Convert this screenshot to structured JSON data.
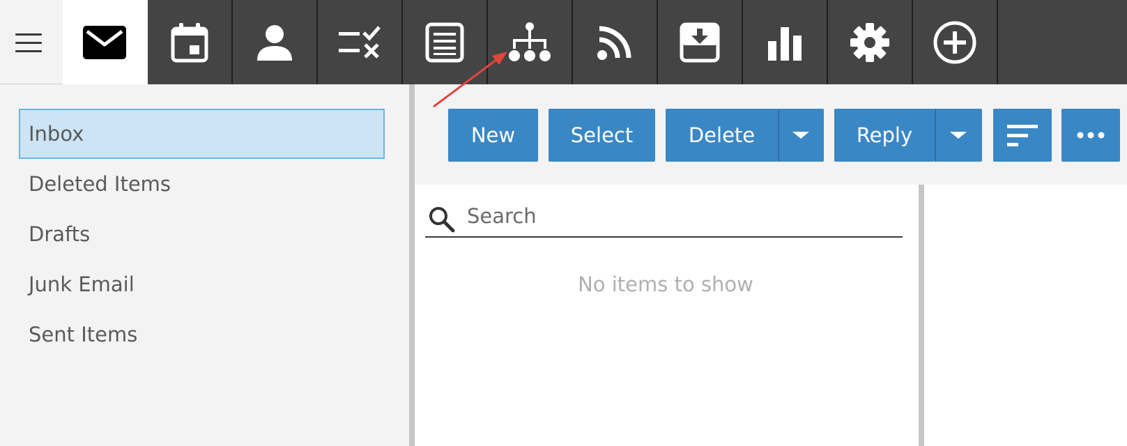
{
  "nav": {
    "tabs": [
      {
        "icon": "mail-icon",
        "active": true
      },
      {
        "icon": "calendar-icon",
        "active": false
      },
      {
        "icon": "person-icon",
        "active": false
      },
      {
        "icon": "tasks-icon",
        "active": false
      },
      {
        "icon": "notes-icon",
        "active": false
      },
      {
        "icon": "org-chart-icon",
        "active": false
      },
      {
        "icon": "rss-icon",
        "active": false
      },
      {
        "icon": "archive-icon",
        "active": false
      },
      {
        "icon": "bar-chart-icon",
        "active": false
      },
      {
        "icon": "gear-icon",
        "active": false
      },
      {
        "icon": "add-circle-icon",
        "active": false
      }
    ]
  },
  "folders": {
    "items": [
      {
        "label": "Inbox",
        "selected": true
      },
      {
        "label": "Deleted Items",
        "selected": false
      },
      {
        "label": "Drafts",
        "selected": false
      },
      {
        "label": "Junk Email",
        "selected": false
      },
      {
        "label": "Sent Items",
        "selected": false
      }
    ]
  },
  "toolbar": {
    "new_label": "New",
    "select_label": "Select",
    "delete_label": "Delete",
    "reply_label": "Reply"
  },
  "list": {
    "search_placeholder": "Search",
    "empty_text": "No items to show"
  },
  "colors": {
    "accent": "#3a87c6",
    "topbar": "#444444",
    "selected_folder": "#cce4f5",
    "annotation_arrow": "#e2453c"
  }
}
